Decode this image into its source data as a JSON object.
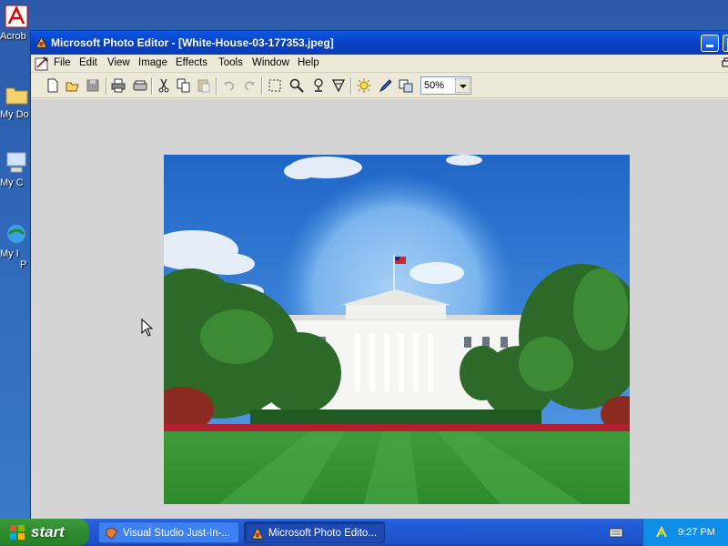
{
  "desktop": {
    "icons": [
      {
        "label": "Acrob",
        "icon": "acrobat-icon"
      },
      {
        "label": "My Do",
        "icon": "my-documents-icon"
      },
      {
        "label": "My C",
        "icon": "my-computer-icon"
      },
      {
        "label": "My I",
        "label2": "P",
        "icon": "internet-explorer-icon"
      }
    ]
  },
  "window": {
    "title": "Microsoft Photo Editor - [White-House-03-177353.jpeg]",
    "menu": [
      "File",
      "Edit",
      "View",
      "Image",
      "Effects",
      "Tools",
      "Window",
      "Help"
    ],
    "toolbar": {
      "buttons": [
        "new-icon",
        "open-icon",
        "save-icon",
        "print-icon",
        "scan-icon",
        "cut-icon",
        "copy-icon",
        "paste-icon",
        "undo-icon",
        "redo-icon",
        "select-icon",
        "zoom-icon",
        "smudge-icon",
        "transparency-icon",
        "balance-icon",
        "pen-icon",
        "properties-icon"
      ],
      "zoom_value": "50%"
    },
    "image_subject": "White House with lawn, trees and blue sky"
  },
  "taskbar": {
    "start_label": "start",
    "tasks": [
      {
        "label": "Visual Studio Just-In-...",
        "active": false
      },
      {
        "label": "Microsoft Photo Edito...",
        "active": true
      }
    ],
    "clock": "9:27 PM"
  }
}
